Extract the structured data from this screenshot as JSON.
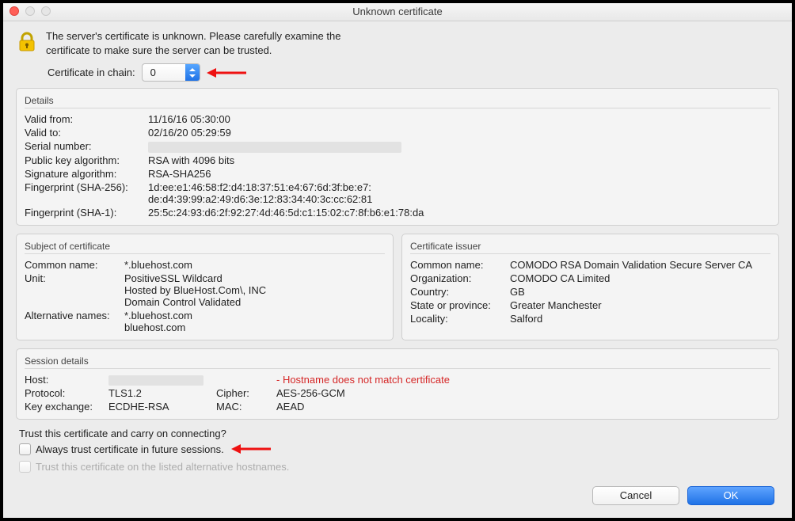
{
  "window": {
    "title": "Unknown certificate"
  },
  "intro": {
    "line1": "The server's certificate is unknown. Please carefully examine the",
    "line2": "certificate to make sure the server can be trusted.",
    "chain_label": "Certificate in chain:",
    "chain_value": "0"
  },
  "details": {
    "heading": "Details",
    "valid_from_k": "Valid from:",
    "valid_from_v": "11/16/16 05:30:00",
    "valid_to_k": "Valid to:",
    "valid_to_v": "02/16/20 05:29:59",
    "serial_k": "Serial number:",
    "pk_algo_k": "Public key algorithm:",
    "pk_algo_v": "RSA with 4096 bits",
    "sig_algo_k": "Signature algorithm:",
    "sig_algo_v": "RSA-SHA256",
    "fp256_k": "Fingerprint (SHA-256):",
    "fp256_v": "1d:ee:e1:46:58:f2:d4:18:37:51:e4:67:6d:3f:be:e7:\nde:d4:39:99:a2:49:d6:3e:12:83:34:40:3c:cc:62:81",
    "fp1_k": "Fingerprint (SHA-1):",
    "fp1_v": "25:5c:24:93:d6:2f:92:27:4d:46:5d:c1:15:02:c7:8f:b6:e1:78:da"
  },
  "subject": {
    "heading": "Subject of certificate",
    "cn_k": "Common name:",
    "cn_v": "*.bluehost.com",
    "unit_k": "Unit:",
    "unit_v": "PositiveSSL Wildcard\nHosted by BlueHost.Com\\, INC\nDomain Control Validated",
    "alt_k": "Alternative names:",
    "alt_v": "*.bluehost.com\nbluehost.com"
  },
  "issuer": {
    "heading": "Certificate issuer",
    "cn_k": "Common name:",
    "cn_v": "COMODO RSA Domain Validation Secure Server CA",
    "org_k": "Organization:",
    "org_v": "COMODO CA Limited",
    "country_k": "Country:",
    "country_v": "GB",
    "state_k": "State or province:",
    "state_v": "Greater Manchester",
    "locality_k": "Locality:",
    "locality_v": "Salford"
  },
  "session": {
    "heading": "Session details",
    "host_k": "Host:",
    "host_err": "- Hostname does not match certificate",
    "proto_k": "Protocol:",
    "proto_v": "TLS1.2",
    "cipher_k": "Cipher:",
    "cipher_v": "AES-256-GCM",
    "kex_k": "Key exchange:",
    "kex_v": "ECDHE-RSA",
    "mac_k": "MAC:",
    "mac_v": "AEAD"
  },
  "trust": {
    "prompt": "Trust this certificate and carry on connecting?",
    "always": "Always trust certificate in future sessions.",
    "alt_hosts": "Trust this certificate on the listed alternative hostnames."
  },
  "buttons": {
    "cancel": "Cancel",
    "ok": "OK"
  }
}
